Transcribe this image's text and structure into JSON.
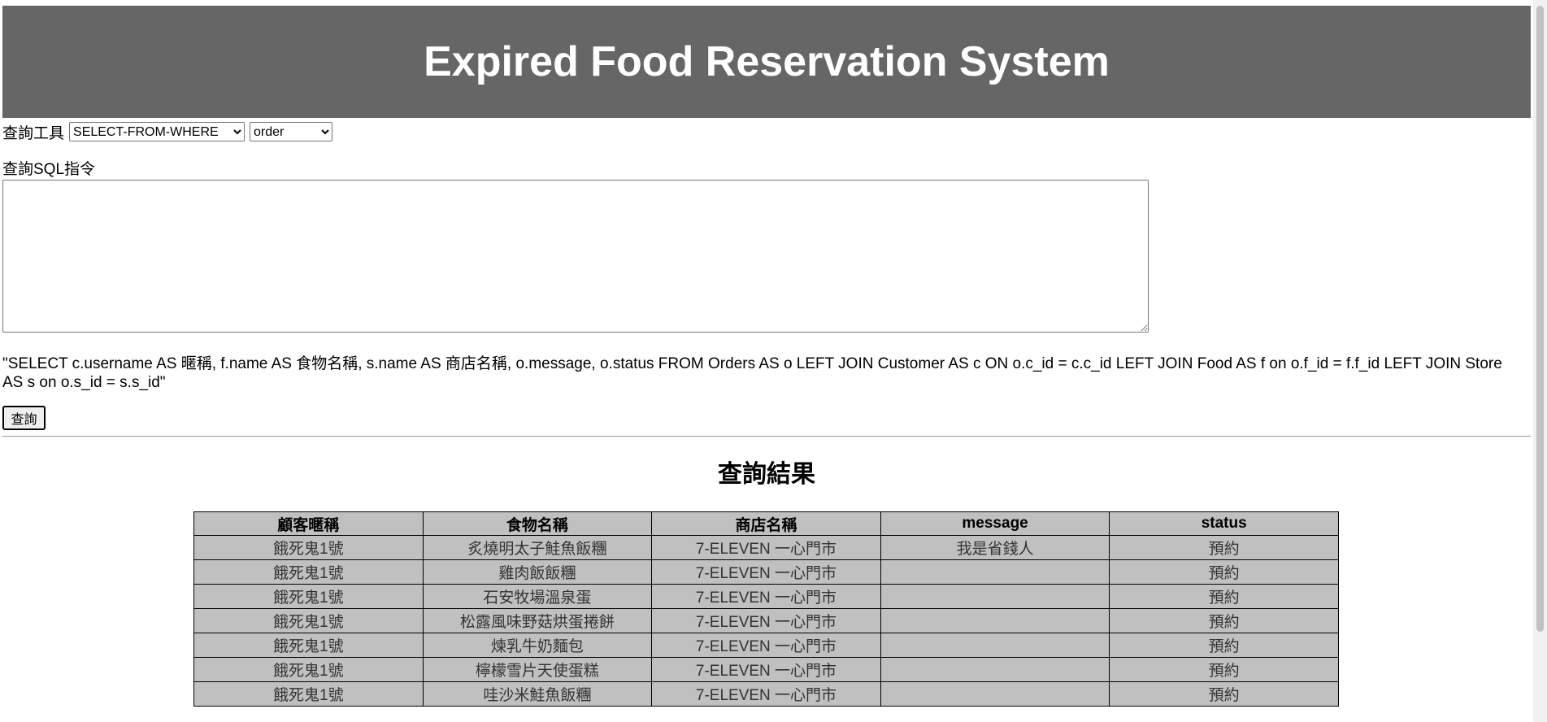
{
  "header": {
    "title": "Expired Food Reservation System"
  },
  "tools": {
    "label": "查詢工具",
    "query_type": {
      "selected": "SELECT-FROM-WHERE"
    },
    "table": {
      "selected": "order"
    }
  },
  "sql": {
    "label": "查詢SQL指令",
    "textarea_value": "",
    "command_text": "\"SELECT c.username AS 暱稱, f.name AS 食物名稱, s.name AS 商店名稱, o.message, o.status FROM Orders AS o LEFT JOIN Customer AS c ON o.c_id = c.c_id LEFT JOIN Food AS f on o.f_id = f.f_id LEFT JOIN Store AS s on o.s_id = s.s_id\"",
    "query_button": "查詢"
  },
  "results": {
    "title": "查詢結果",
    "columns": [
      "顧客暱稱",
      "食物名稱",
      "商店名稱",
      "message",
      "status"
    ],
    "rows": [
      [
        "餓死鬼1號",
        "炙燒明太子鮭魚飯糰",
        "7-ELEVEN 一心門市",
        "我是省錢人",
        "預約"
      ],
      [
        "餓死鬼1號",
        "雞肉飯飯糰",
        "7-ELEVEN 一心門市",
        "",
        "預約"
      ],
      [
        "餓死鬼1號",
        "石安牧場溫泉蛋",
        "7-ELEVEN 一心門市",
        "",
        "預約"
      ],
      [
        "餓死鬼1號",
        "松露風味野菇烘蛋捲餅",
        "7-ELEVEN 一心門市",
        "",
        "預約"
      ],
      [
        "餓死鬼1號",
        "煉乳牛奶麵包",
        "7-ELEVEN 一心門市",
        "",
        "預約"
      ],
      [
        "餓死鬼1號",
        "檸檬雪片天使蛋糕",
        "7-ELEVEN 一心門市",
        "",
        "預約"
      ],
      [
        "餓死鬼1號",
        "哇沙米鮭魚飯糰",
        "7-ELEVEN 一心門市",
        "",
        "預約"
      ]
    ]
  }
}
